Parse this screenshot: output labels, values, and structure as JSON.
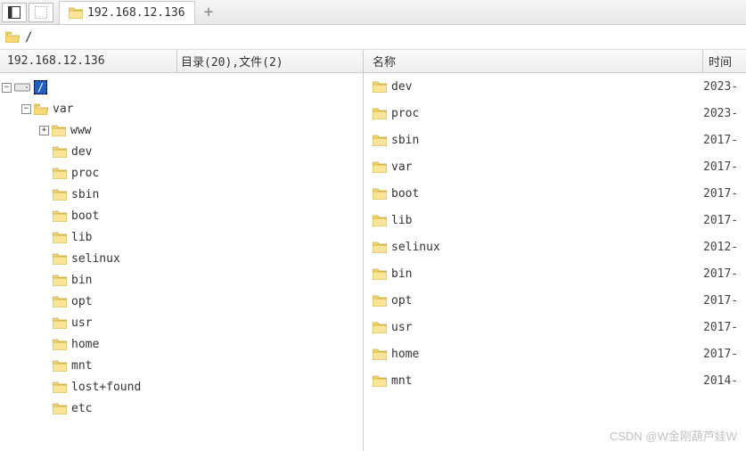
{
  "tab": {
    "title": "192.168.12.136"
  },
  "new_tab_label": "+",
  "path": "/",
  "left_header": {
    "host": "192.168.12.136",
    "summary": "目录(20),文件(2)"
  },
  "right_header": {
    "name": "名称",
    "time": "时间"
  },
  "tree": {
    "root_label": "/",
    "var": "var",
    "www": "www",
    "items": [
      "dev",
      "proc",
      "sbin",
      "boot",
      "lib",
      "selinux",
      "bin",
      "opt",
      "usr",
      "home",
      "mnt",
      "lost+found",
      "etc"
    ]
  },
  "files": [
    {
      "name": "dev",
      "time": "2023-"
    },
    {
      "name": "proc",
      "time": "2023-"
    },
    {
      "name": "sbin",
      "time": "2017-"
    },
    {
      "name": "var",
      "time": "2017-"
    },
    {
      "name": "boot",
      "time": "2017-"
    },
    {
      "name": "lib",
      "time": "2017-"
    },
    {
      "name": "selinux",
      "time": "2012-"
    },
    {
      "name": "bin",
      "time": "2017-"
    },
    {
      "name": "opt",
      "time": "2017-"
    },
    {
      "name": "usr",
      "time": "2017-"
    },
    {
      "name": "home",
      "time": "2017-"
    },
    {
      "name": "mnt",
      "time": "2014-"
    }
  ],
  "watermark": "CSDN @W金刚葫芦娃W"
}
